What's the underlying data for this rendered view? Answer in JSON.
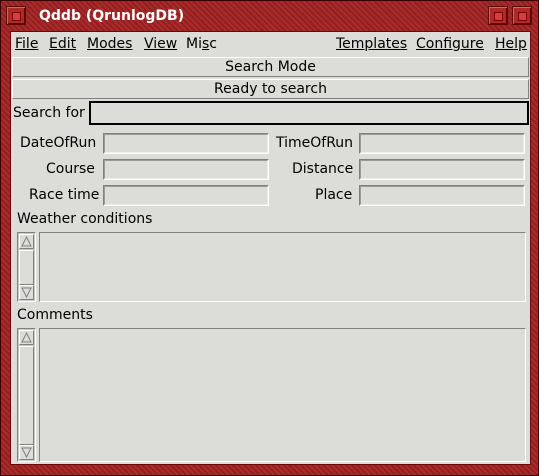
{
  "window": {
    "title": "Qddb (QrunlogDB)"
  },
  "menubar": {
    "file": "File",
    "edit": "Edit",
    "modes": "Modes",
    "view": "View",
    "misc": "Misc",
    "templates": "Templates",
    "configure": "Configure",
    "help": "Help"
  },
  "mode_bar": "Search Mode",
  "status_bar": "Ready to search",
  "search": {
    "label": "Search for",
    "value": ""
  },
  "fields": {
    "date_of_run": "DateOfRun",
    "time_of_run": "TimeOfRun",
    "course": "Course",
    "distance": "Distance",
    "race_time": "Race time",
    "place": "Place",
    "weather": "Weather conditions",
    "comments": "Comments"
  },
  "colors": {
    "title_bg": "#a02020",
    "panel_bg": "#dcdcd8"
  }
}
